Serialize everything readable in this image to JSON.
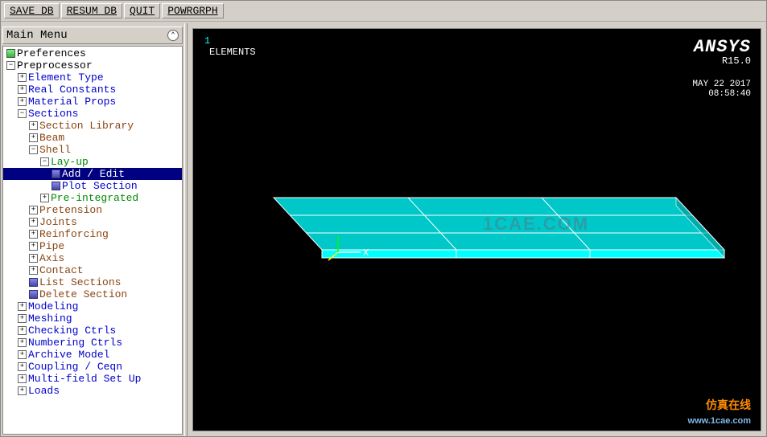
{
  "toolbar": {
    "save_db": "SAVE_DB",
    "resum_db": "RESUM_DB",
    "quit": "QUIT",
    "powrgrph": "POWRGRPH"
  },
  "tree_panel": {
    "title": "Main Menu"
  },
  "tree": [
    {
      "depth": 0,
      "exp": "",
      "icon": "green",
      "cls": "black",
      "label": "Preferences"
    },
    {
      "depth": 0,
      "exp": "-",
      "icon": "",
      "cls": "black",
      "label": "Preprocessor"
    },
    {
      "depth": 1,
      "exp": "+",
      "icon": "",
      "cls": "",
      "label": "Element Type"
    },
    {
      "depth": 1,
      "exp": "+",
      "icon": "",
      "cls": "",
      "label": "Real Constants"
    },
    {
      "depth": 1,
      "exp": "+",
      "icon": "",
      "cls": "",
      "label": "Material Props"
    },
    {
      "depth": 1,
      "exp": "-",
      "icon": "",
      "cls": "",
      "label": "Sections"
    },
    {
      "depth": 2,
      "exp": "+",
      "icon": "",
      "cls": "brown",
      "label": "Section Library"
    },
    {
      "depth": 2,
      "exp": "+",
      "icon": "",
      "cls": "brown",
      "label": "Beam"
    },
    {
      "depth": 2,
      "exp": "-",
      "icon": "",
      "cls": "brown",
      "label": "Shell"
    },
    {
      "depth": 3,
      "exp": "-",
      "icon": "",
      "cls": "green",
      "label": "Lay-up"
    },
    {
      "depth": 4,
      "exp": "",
      "icon": "blue",
      "cls": "",
      "label": "Add / Edit",
      "selected": true
    },
    {
      "depth": 4,
      "exp": "",
      "icon": "blue",
      "cls": "",
      "label": "Plot Section"
    },
    {
      "depth": 3,
      "exp": "+",
      "icon": "",
      "cls": "green",
      "label": "Pre-integrated"
    },
    {
      "depth": 2,
      "exp": "+",
      "icon": "",
      "cls": "brown",
      "label": "Pretension"
    },
    {
      "depth": 2,
      "exp": "+",
      "icon": "",
      "cls": "brown",
      "label": "Joints"
    },
    {
      "depth": 2,
      "exp": "+",
      "icon": "",
      "cls": "brown",
      "label": "Reinforcing"
    },
    {
      "depth": 2,
      "exp": "+",
      "icon": "",
      "cls": "brown",
      "label": "Pipe"
    },
    {
      "depth": 2,
      "exp": "+",
      "icon": "",
      "cls": "brown",
      "label": "Axis"
    },
    {
      "depth": 2,
      "exp": "+",
      "icon": "",
      "cls": "brown",
      "label": "Contact"
    },
    {
      "depth": 2,
      "exp": "",
      "icon": "blue",
      "cls": "brown",
      "label": "List Sections"
    },
    {
      "depth": 2,
      "exp": "",
      "icon": "blue",
      "cls": "brown",
      "label": "Delete Section"
    },
    {
      "depth": 1,
      "exp": "+",
      "icon": "",
      "cls": "",
      "label": "Modeling"
    },
    {
      "depth": 1,
      "exp": "+",
      "icon": "",
      "cls": "",
      "label": "Meshing"
    },
    {
      "depth": 1,
      "exp": "+",
      "icon": "",
      "cls": "",
      "label": "Checking Ctrls"
    },
    {
      "depth": 1,
      "exp": "+",
      "icon": "",
      "cls": "",
      "label": "Numbering Ctrls"
    },
    {
      "depth": 1,
      "exp": "+",
      "icon": "",
      "cls": "",
      "label": "Archive Model"
    },
    {
      "depth": 1,
      "exp": "+",
      "icon": "",
      "cls": "",
      "label": "Coupling / Ceqn"
    },
    {
      "depth": 1,
      "exp": "+",
      "icon": "",
      "cls": "",
      "label": "Multi-field Set Up"
    },
    {
      "depth": 1,
      "exp": "+",
      "icon": "",
      "cls": "",
      "label": "Loads"
    }
  ],
  "viewport": {
    "number": "1",
    "title": "ELEMENTS",
    "brand": "ANSYS",
    "version": "R15.0",
    "date": "MAY 22 2017",
    "time": "08:58:40",
    "axis_x": "X",
    "watermark_center": "1CAE.COM",
    "watermark_br1": "仿真在线",
    "watermark_br2": "www.1cae.com"
  }
}
